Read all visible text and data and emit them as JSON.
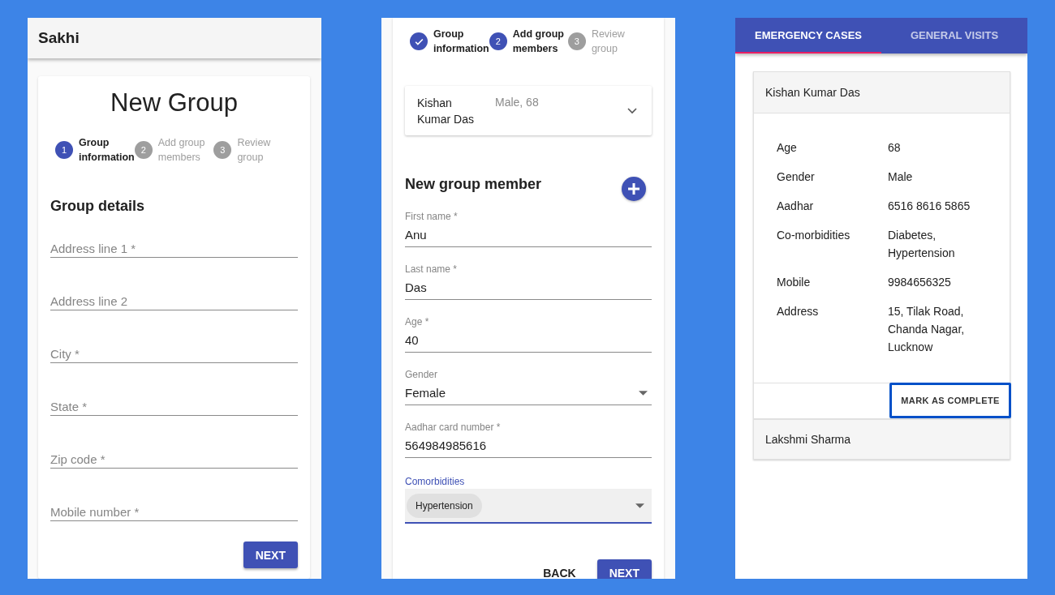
{
  "new_group_screen": {
    "app_bar": {
      "title": "Sakhi"
    },
    "title": "New Group",
    "steps": [
      {
        "number": "1",
        "label": "Group information",
        "active": true,
        "completed": false
      },
      {
        "number": "2",
        "label": "Add group members",
        "active": false,
        "completed": false
      },
      {
        "number": "3",
        "label": "Review group",
        "active": false,
        "completed": false
      }
    ],
    "section_title": "Group details",
    "fields": [
      {
        "placeholder": "Address line 1 *"
      },
      {
        "placeholder": "Address line 2"
      },
      {
        "placeholder": "City *"
      },
      {
        "placeholder": "State *"
      },
      {
        "placeholder": "Zip code *"
      },
      {
        "placeholder": "Mobile number *"
      }
    ],
    "next_button": "NEXT"
  },
  "add_members_screen": {
    "steps": [
      {
        "label": "Group information",
        "completed": true
      },
      {
        "number": "2",
        "label": "Add group members",
        "active": true,
        "completed": false
      },
      {
        "number": "3",
        "label": "Review group",
        "active": false,
        "completed": false
      }
    ],
    "member": {
      "name": "Kishan Kumar Das",
      "summary": "Male, 68",
      "expanded": false
    },
    "section_title": "New group member",
    "fields": [
      {
        "kind": "text",
        "label": "First name *",
        "value": "Anu"
      },
      {
        "kind": "text",
        "label": "Last name *",
        "value": "Das"
      },
      {
        "kind": "text",
        "label": "Age *",
        "value": "40"
      },
      {
        "kind": "select",
        "label": "Gender",
        "value": "Female"
      },
      {
        "kind": "text",
        "label": "Aadhar card number *",
        "value": "564984985616"
      },
      {
        "kind": "chips",
        "label": "Comorbidities",
        "chips": [
          "Hypertension"
        ],
        "focused": true
      }
    ],
    "back_button": "BACK",
    "next_button": "NEXT"
  },
  "cases_screen": {
    "tabs": [
      {
        "label": "EMERGENCY CASES",
        "selected": true
      },
      {
        "label": "GENERAL VISITS",
        "selected": false
      }
    ],
    "cases": [
      {
        "name": "Kishan Kumar Das",
        "expanded": true,
        "details": [
          {
            "label": "Age",
            "value": "68"
          },
          {
            "label": "Gender",
            "value": "Male"
          },
          {
            "label": "Aadhar",
            "value": "6516 8616 5865"
          },
          {
            "label": "Co-morbidities",
            "value": "Diabetes, Hypertension"
          },
          {
            "label": "Mobile",
            "value": "9984656325"
          },
          {
            "label": "Address",
            "value": "15, Tilak Road, Chanda Nagar, Lucknow"
          }
        ],
        "action": "MARK AS COMPLETE",
        "action_focused": true
      },
      {
        "name": "Lakshmi Sharma",
        "expanded": false
      }
    ]
  }
}
